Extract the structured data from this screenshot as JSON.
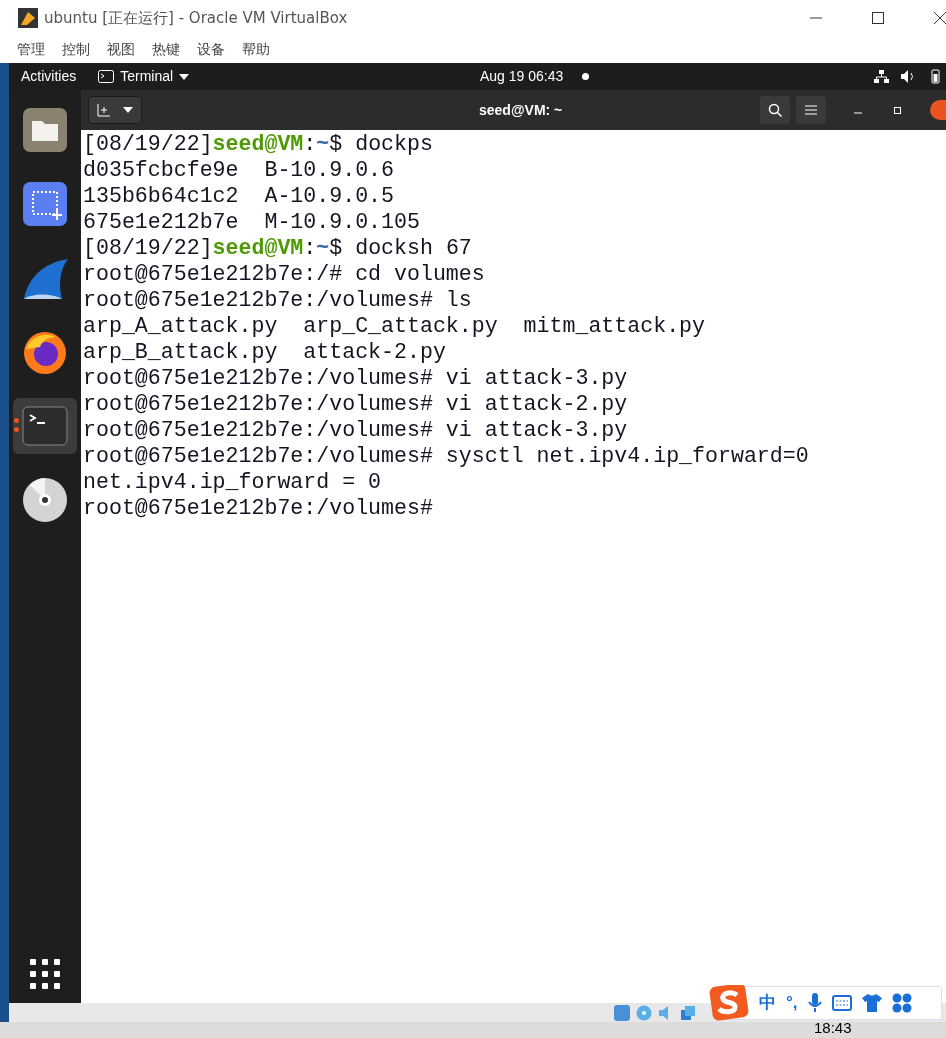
{
  "window": {
    "title": "ubuntu [正在运行] - Oracle VM VirtualBox"
  },
  "menu": [
    "管理",
    "控制",
    "视图",
    "热键",
    "设备",
    "帮助"
  ],
  "topbar": {
    "activities": "Activities",
    "app": "Terminal",
    "clock": "Aug 19  06:43"
  },
  "dock": [
    {
      "kind": "files",
      "selected": false,
      "running": false
    },
    {
      "kind": "screenshot",
      "selected": false,
      "running": false
    },
    {
      "kind": "wireshark",
      "selected": false,
      "running": false
    },
    {
      "kind": "firefox",
      "selected": false,
      "running": false
    },
    {
      "kind": "terminal",
      "selected": true,
      "running": true
    },
    {
      "kind": "disc",
      "selected": false,
      "running": false
    }
  ],
  "terminal": {
    "title": "seed@VM: ~",
    "lines": [
      [
        {
          "kind": "plain",
          "text": "[08/19/22]"
        },
        {
          "kind": "user",
          "text": "seed@VM"
        },
        {
          "kind": "plain",
          "text": ":"
        },
        {
          "kind": "path",
          "text": "~"
        },
        {
          "kind": "plain",
          "text": "$ dockps"
        }
      ],
      [
        {
          "kind": "plain",
          "text": "d035fcbcfe9e  B-10.9.0.6"
        }
      ],
      [
        {
          "kind": "plain",
          "text": "135b6b64c1c2  A-10.9.0.5"
        }
      ],
      [
        {
          "kind": "plain",
          "text": "675e1e212b7e  M-10.9.0.105"
        }
      ],
      [
        {
          "kind": "plain",
          "text": "[08/19/22]"
        },
        {
          "kind": "user",
          "text": "seed@VM"
        },
        {
          "kind": "plain",
          "text": ":"
        },
        {
          "kind": "path",
          "text": "~"
        },
        {
          "kind": "plain",
          "text": "$ docksh 67"
        }
      ],
      [
        {
          "kind": "plain",
          "text": "root@675e1e212b7e:/# cd volumes"
        }
      ],
      [
        {
          "kind": "plain",
          "text": "root@675e1e212b7e:/volumes# ls"
        }
      ],
      [
        {
          "kind": "plain",
          "text": "arp_A_attack.py  arp_C_attack.py  mitm_attack.py"
        }
      ],
      [
        {
          "kind": "plain",
          "text": "arp_B_attack.py  attack-2.py"
        }
      ],
      [
        {
          "kind": "plain",
          "text": "root@675e1e212b7e:/volumes# vi attack-3.py"
        }
      ],
      [
        {
          "kind": "plain",
          "text": "root@675e1e212b7e:/volumes# vi attack-2.py"
        }
      ],
      [
        {
          "kind": "plain",
          "text": "root@675e1e212b7e:/volumes# vi attack-3.py"
        }
      ],
      [
        {
          "kind": "plain",
          "text": "root@675e1e212b7e:/volumes# sysctl net.ipv4.ip_forward=0"
        }
      ],
      [
        {
          "kind": "plain",
          "text": "net.ipv4.ip_forward = 0"
        }
      ],
      [
        {
          "kind": "plain",
          "text": "root@675e1e212b7e:/volumes#"
        }
      ]
    ]
  },
  "ime": {
    "lang": "中",
    "punct": "°,"
  },
  "taskbar": {
    "time": "18:43"
  }
}
